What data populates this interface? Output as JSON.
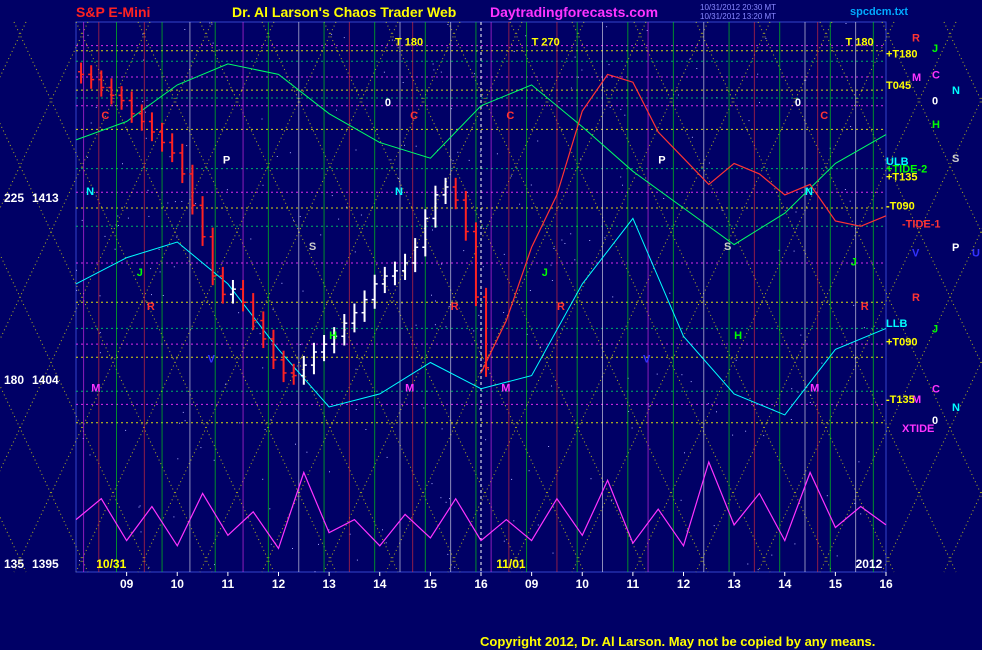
{
  "header": {
    "symbol": "S&P E-Mini",
    "title": "Dr. Al Larson's Chaos Trader Web",
    "site": "Daytradingforecasts.com",
    "file": "spcdcm.txt",
    "stamp1": "10/31/2012 20:30 MT",
    "stamp2": "10/31/2012 13:20 MT"
  },
  "copyright": "Copyright 2012, Dr. Al Larson. May not be copied by any means.",
  "colors": {
    "background": "#000066",
    "bar_up": "#ffffff",
    "bar_down": "#ff0000",
    "grid_yellow": "#ffff00",
    "grid_green": "#00cc00",
    "magenta": "#ff33ff",
    "cyan": "#00ffff"
  },
  "chart_data": {
    "type": "line",
    "title": "S&P E-Mini",
    "y_labels": [
      {
        "angle": "225",
        "price": "1413"
      },
      {
        "angle": "180",
        "price": "1404"
      },
      {
        "angle": "135",
        "price": "1395"
      }
    ],
    "ylim": [
      1395,
      1416
    ],
    "x_ticks_left": [
      "09",
      "10",
      "11",
      "12",
      "13",
      "14",
      "15",
      "16"
    ],
    "x_ticks_right": [
      "09",
      "10",
      "11",
      "12",
      "13",
      "14",
      "15",
      "16"
    ],
    "date_left": "10/31",
    "date_right": "11/01",
    "year": "2012",
    "price_series": {
      "x": [
        8.1,
        8.3,
        8.5,
        8.7,
        8.9,
        9.1,
        9.3,
        9.5,
        9.7,
        9.9,
        10.1,
        10.3,
        10.5,
        10.7,
        10.9,
        11.1,
        11.3,
        11.5,
        11.7,
        11.9,
        12.1,
        12.3,
        12.5,
        12.7,
        12.9,
        13.1,
        13.3,
        13.5,
        13.7,
        13.9,
        14.1,
        14.3,
        14.5,
        14.7,
        14.9,
        15.1,
        15.3,
        15.5,
        15.7,
        15.9,
        16.1
      ],
      "open": [
        1414.1,
        1414.0,
        1413.8,
        1413.5,
        1413.2,
        1413.0,
        1412.5,
        1412.2,
        1411.8,
        1411.4,
        1411.0,
        1410.2,
        1409.0,
        1407.8,
        1406.3,
        1405.6,
        1405.8,
        1405.3,
        1404.6,
        1403.9,
        1403.1,
        1402.6,
        1402.5,
        1402.9,
        1403.4,
        1403.7,
        1404.0,
        1404.5,
        1404.9,
        1405.4,
        1406.0,
        1406.3,
        1406.5,
        1406.8,
        1407.4,
        1408.5,
        1409.4,
        1409.7,
        1409.2,
        1408.0,
        1405.5
      ],
      "close": [
        1414.0,
        1413.8,
        1413.5,
        1413.2,
        1413.0,
        1412.5,
        1412.2,
        1411.8,
        1411.4,
        1411.0,
        1410.2,
        1409.0,
        1407.8,
        1406.3,
        1405.6,
        1405.8,
        1405.3,
        1404.6,
        1403.9,
        1403.1,
        1402.6,
        1402.5,
        1402.9,
        1403.4,
        1403.7,
        1404.0,
        1404.5,
        1404.9,
        1405.4,
        1406.0,
        1406.3,
        1406.5,
        1406.8,
        1407.4,
        1408.5,
        1409.4,
        1409.7,
        1409.2,
        1408.0,
        1405.5,
        1402.8
      ]
    },
    "tide_series": {
      "name": "XTIDE",
      "x": [
        8.0,
        8.5,
        9.0,
        9.5,
        10.0,
        10.5,
        11.0,
        11.5,
        12.0,
        12.5,
        13.0,
        13.5,
        14.0,
        14.5,
        15.0,
        15.5,
        16.0,
        16.5,
        17.0,
        17.5,
        18.0,
        18.5,
        19.0,
        19.5,
        20.0,
        20.5,
        21.0,
        21.5,
        22.0,
        22.5,
        23.0,
        23.5,
        24.0
      ],
      "y": [
        1397.0,
        1397.8,
        1396.2,
        1397.5,
        1396.0,
        1398.0,
        1396.4,
        1397.3,
        1395.9,
        1398.8,
        1396.5,
        1397.0,
        1396.0,
        1397.2,
        1396.3,
        1397.8,
        1396.2,
        1397.0,
        1396.2,
        1397.8,
        1396.4,
        1398.5,
        1396.1,
        1397.4,
        1396.0,
        1399.2,
        1396.8,
        1398.0,
        1396.2,
        1398.8,
        1396.7,
        1397.5,
        1396.8
      ]
    },
    "band_upper": {
      "x": [
        8.0,
        9.0,
        10.0,
        11.0,
        12.0,
        13.0,
        14.0,
        15.0,
        16.0,
        17.0,
        18.0,
        19.0,
        20.0,
        21.0,
        22.0,
        23.0,
        24.0
      ],
      "y": [
        1411.5,
        1412.2,
        1413.6,
        1414.4,
        1414.0,
        1412.5,
        1411.4,
        1410.8,
        1412.8,
        1413.6,
        1412.0,
        1410.3,
        1408.9,
        1407.5,
        1408.7,
        1410.6,
        1411.7
      ]
    },
    "band_lower": {
      "x": [
        8.0,
        9.0,
        10.0,
        11.0,
        12.0,
        13.0,
        14.0,
        15.0,
        16.0,
        17.0,
        18.0,
        19.0,
        20.0,
        21.0,
        22.0,
        23.0,
        24.0
      ],
      "y": [
        1406.0,
        1407.0,
        1407.6,
        1406.0,
        1403.5,
        1401.3,
        1401.8,
        1403.0,
        1402.0,
        1402.5,
        1406.0,
        1408.5,
        1404.0,
        1401.8,
        1401.0,
        1403.5,
        1404.3
      ]
    },
    "forecast_series": {
      "name": "TIDE",
      "x": [
        16.0,
        16.5,
        17.0,
        17.5,
        18.0,
        18.5,
        19.0,
        19.5,
        20.0,
        20.5,
        21.0,
        21.5,
        22.0,
        22.5,
        23.0,
        23.5,
        24.0
      ],
      "y": [
        1402.6,
        1404.6,
        1407.4,
        1409.4,
        1412.6,
        1414.0,
        1413.7,
        1411.8,
        1410.8,
        1409.8,
        1410.6,
        1410.2,
        1409.4,
        1409.8,
        1408.4,
        1408.2,
        1408.6
      ]
    },
    "right_labels": [
      {
        "text": "R",
        "color": "#ff3333",
        "yv": 1415.4
      },
      {
        "text": "J",
        "color": "#00ff00",
        "yv": 1415.0
      },
      {
        "text": "+T180",
        "color": "#ffff00",
        "yv": 1414.8
      },
      {
        "text": "M",
        "color": "#ff33ff",
        "yv": 1413.9
      },
      {
        "text": "C",
        "color": "#ff33ff",
        "yv": 1414.0
      },
      {
        "text": "T045",
        "color": "#ffff00",
        "yv": 1413.6
      },
      {
        "text": "N",
        "color": "#00ffff",
        "yv": 1413.4
      },
      {
        "text": "0",
        "color": "#ffffff",
        "yv": 1413.0
      },
      {
        "text": "H",
        "color": "#00ff00",
        "yv": 1412.1
      },
      {
        "text": "ULB",
        "color": "#00ffff",
        "yv": 1410.7
      },
      {
        "text": "S",
        "color": "#cccccc",
        "yv": 1410.8
      },
      {
        "text": "+TIDE-2",
        "color": "#00ff00",
        "yv": 1410.4
      },
      {
        "text": "+T135",
        "color": "#ffff00",
        "yv": 1410.1
      },
      {
        "text": "-T090",
        "color": "#ffff00",
        "yv": 1409.0
      },
      {
        "text": "-TIDE-1",
        "color": "#ff3333",
        "yv": 1408.3
      },
      {
        "text": "V",
        "color": "#3333ff",
        "yv": 1407.2
      },
      {
        "text": "P",
        "color": "#ffffff",
        "yv": 1407.4
      },
      {
        "text": "U",
        "color": "#3333ff",
        "yv": 1407.2
      },
      {
        "text": "R",
        "color": "#ff3333",
        "yv": 1405.5
      },
      {
        "text": "LLB",
        "color": "#00ffff",
        "yv": 1404.5
      },
      {
        "text": "J",
        "color": "#00ff00",
        "yv": 1404.3
      },
      {
        "text": "+T090",
        "color": "#ffff00",
        "yv": 1403.8
      },
      {
        "text": "M",
        "color": "#ff33ff",
        "yv": 1401.6
      },
      {
        "text": "C",
        "color": "#ff33ff",
        "yv": 1402.0
      },
      {
        "text": "-T135",
        "color": "#ffff00",
        "yv": 1401.6
      },
      {
        "text": "N",
        "color": "#00ffff",
        "yv": 1401.3
      },
      {
        "text": "0",
        "color": "#ffffff",
        "yv": 1400.8
      },
      {
        "text": "XTIDE",
        "color": "#ff33ff",
        "yv": 1400.5
      }
    ],
    "annotations": [
      {
        "text": "T  180",
        "color": "#ffff00",
        "x": 14.3,
        "yv": 1415.1
      },
      {
        "text": "T  270",
        "color": "#ffff00",
        "x": 17.0,
        "yv": 1415.1
      },
      {
        "text": "T  180",
        "color": "#ffff00",
        "x": 23.2,
        "yv": 1415.1
      },
      {
        "text": "0",
        "color": "#ffffff",
        "x": 14.1,
        "yv": 1412.8
      },
      {
        "text": "0",
        "color": "#ffffff",
        "x": 22.2,
        "yv": 1412.8
      },
      {
        "text": "C",
        "color": "#ff3333",
        "x": 8.5,
        "yv": 1412.3
      },
      {
        "text": "C",
        "color": "#ff3333",
        "x": 14.6,
        "yv": 1412.3
      },
      {
        "text": "C",
        "color": "#ff3333",
        "x": 16.5,
        "yv": 1412.3
      },
      {
        "text": "C",
        "color": "#ff3333",
        "x": 22.7,
        "yv": 1412.3
      },
      {
        "text": "P",
        "color": "#ffffff",
        "x": 10.9,
        "yv": 1410.6
      },
      {
        "text": "P",
        "color": "#ffffff",
        "x": 19.5,
        "yv": 1410.6
      },
      {
        "text": "N",
        "color": "#00ffff",
        "x": 8.2,
        "yv": 1409.4
      },
      {
        "text": "N",
        "color": "#00ffff",
        "x": 14.3,
        "yv": 1409.4
      },
      {
        "text": "N",
        "color": "#00ffff",
        "x": 22.4,
        "yv": 1409.4
      },
      {
        "text": "S",
        "color": "#cccccc",
        "x": 12.6,
        "yv": 1407.3
      },
      {
        "text": "S",
        "color": "#cccccc",
        "x": 20.8,
        "yv": 1407.3
      },
      {
        "text": "J",
        "color": "#00ff00",
        "x": 9.2,
        "yv": 1406.3
      },
      {
        "text": "J",
        "color": "#00ff00",
        "x": 17.2,
        "yv": 1406.3
      },
      {
        "text": "J",
        "color": "#00ff00",
        "x": 23.3,
        "yv": 1406.7
      },
      {
        "text": "R",
        "color": "#ff3333",
        "x": 9.4,
        "yv": 1405.0
      },
      {
        "text": "R",
        "color": "#ff3333",
        "x": 15.4,
        "yv": 1405.0
      },
      {
        "text": "R",
        "color": "#ff3333",
        "x": 17.5,
        "yv": 1405.0
      },
      {
        "text": "R",
        "color": "#ff3333",
        "x": 23.5,
        "yv": 1405.0
      },
      {
        "text": "H",
        "color": "#00ff00",
        "x": 13.0,
        "yv": 1403.9
      },
      {
        "text": "H",
        "color": "#00ff00",
        "x": 21.0,
        "yv": 1403.9
      },
      {
        "text": "V",
        "color": "#3333ff",
        "x": 10.6,
        "yv": 1403.0
      },
      {
        "text": "V",
        "color": "#3333ff",
        "x": 19.2,
        "yv": 1403.0
      },
      {
        "text": "M",
        "color": "#ff33ff",
        "x": 8.3,
        "yv": 1401.9
      },
      {
        "text": "M",
        "color": "#ff33ff",
        "x": 14.5,
        "yv": 1401.9
      },
      {
        "text": "M",
        "color": "#ff33ff",
        "x": 16.4,
        "yv": 1401.9
      },
      {
        "text": "M",
        "color": "#ff33ff",
        "x": 22.5,
        "yv": 1401.9
      }
    ]
  }
}
